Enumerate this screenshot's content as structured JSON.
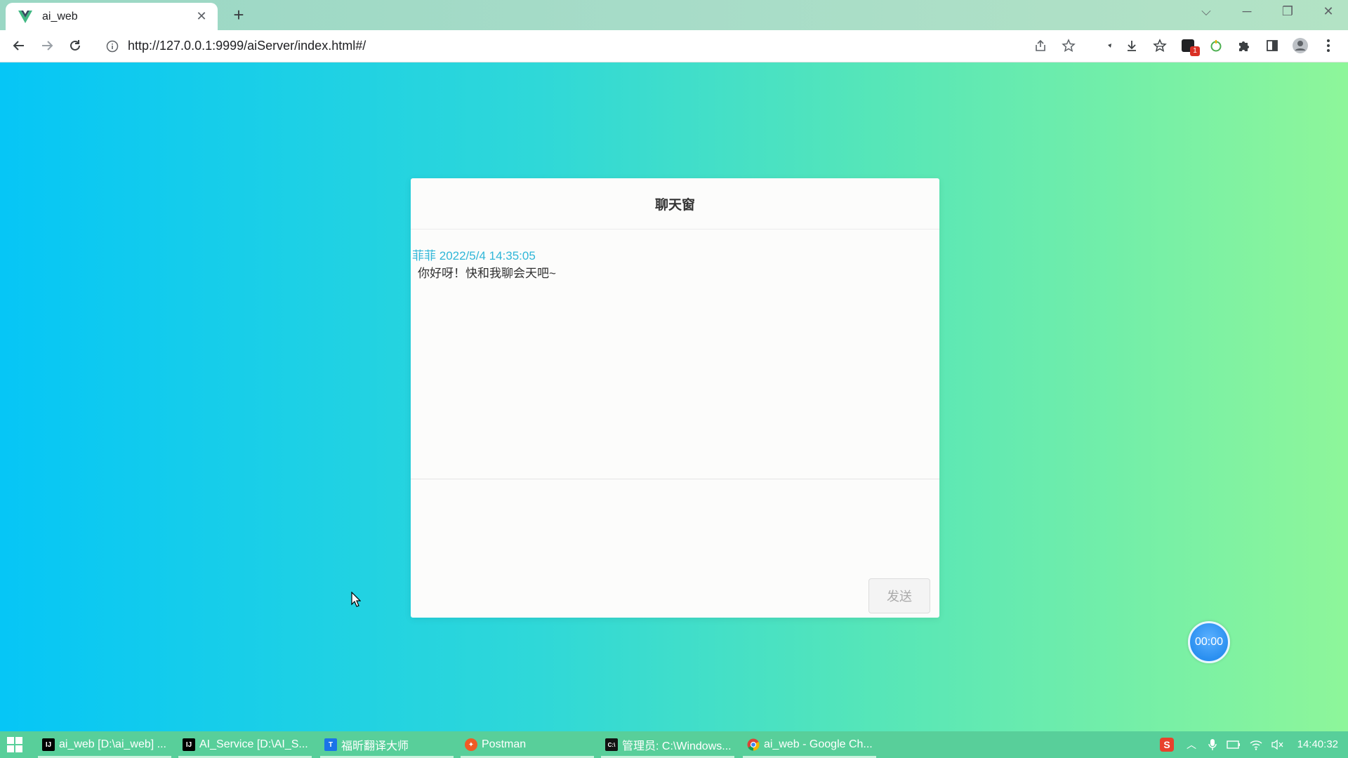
{
  "browser": {
    "tab_title": "ai_web",
    "new_tab": "+",
    "url": "http://127.0.0.1:9999/aiServer/index.html#/",
    "extension_badge": "1"
  },
  "chat": {
    "title": "聊天窗",
    "messages": [
      {
        "sender": "菲菲",
        "time": "2022/5/4 14:35:05",
        "text": "你好呀！快和我聊会天吧~"
      }
    ],
    "input_value": "",
    "send_label": "发送"
  },
  "timer": {
    "label": "00:00"
  },
  "taskbar": {
    "items": [
      {
        "label": "ai_web [D:\\ai_web] ...",
        "icon": "intellij-icon"
      },
      {
        "label": "AI_Service [D:\\AI_S...",
        "icon": "intellij-icon"
      },
      {
        "label": "福昕翻译大师",
        "icon": "foxit-translate-icon"
      },
      {
        "label": "Postman",
        "icon": "postman-icon"
      },
      {
        "label": "管理员: C:\\Windows...",
        "icon": "cmd-icon"
      },
      {
        "label": "ai_web - Google Ch...",
        "icon": "chrome-icon"
      }
    ],
    "clock": "14:40:32"
  },
  "colors": {
    "gradient_start": "#06c6f6",
    "gradient_end": "#8ef69a",
    "sender_meta": "#2fb6d8",
    "taskbar": "#58cf9a"
  }
}
